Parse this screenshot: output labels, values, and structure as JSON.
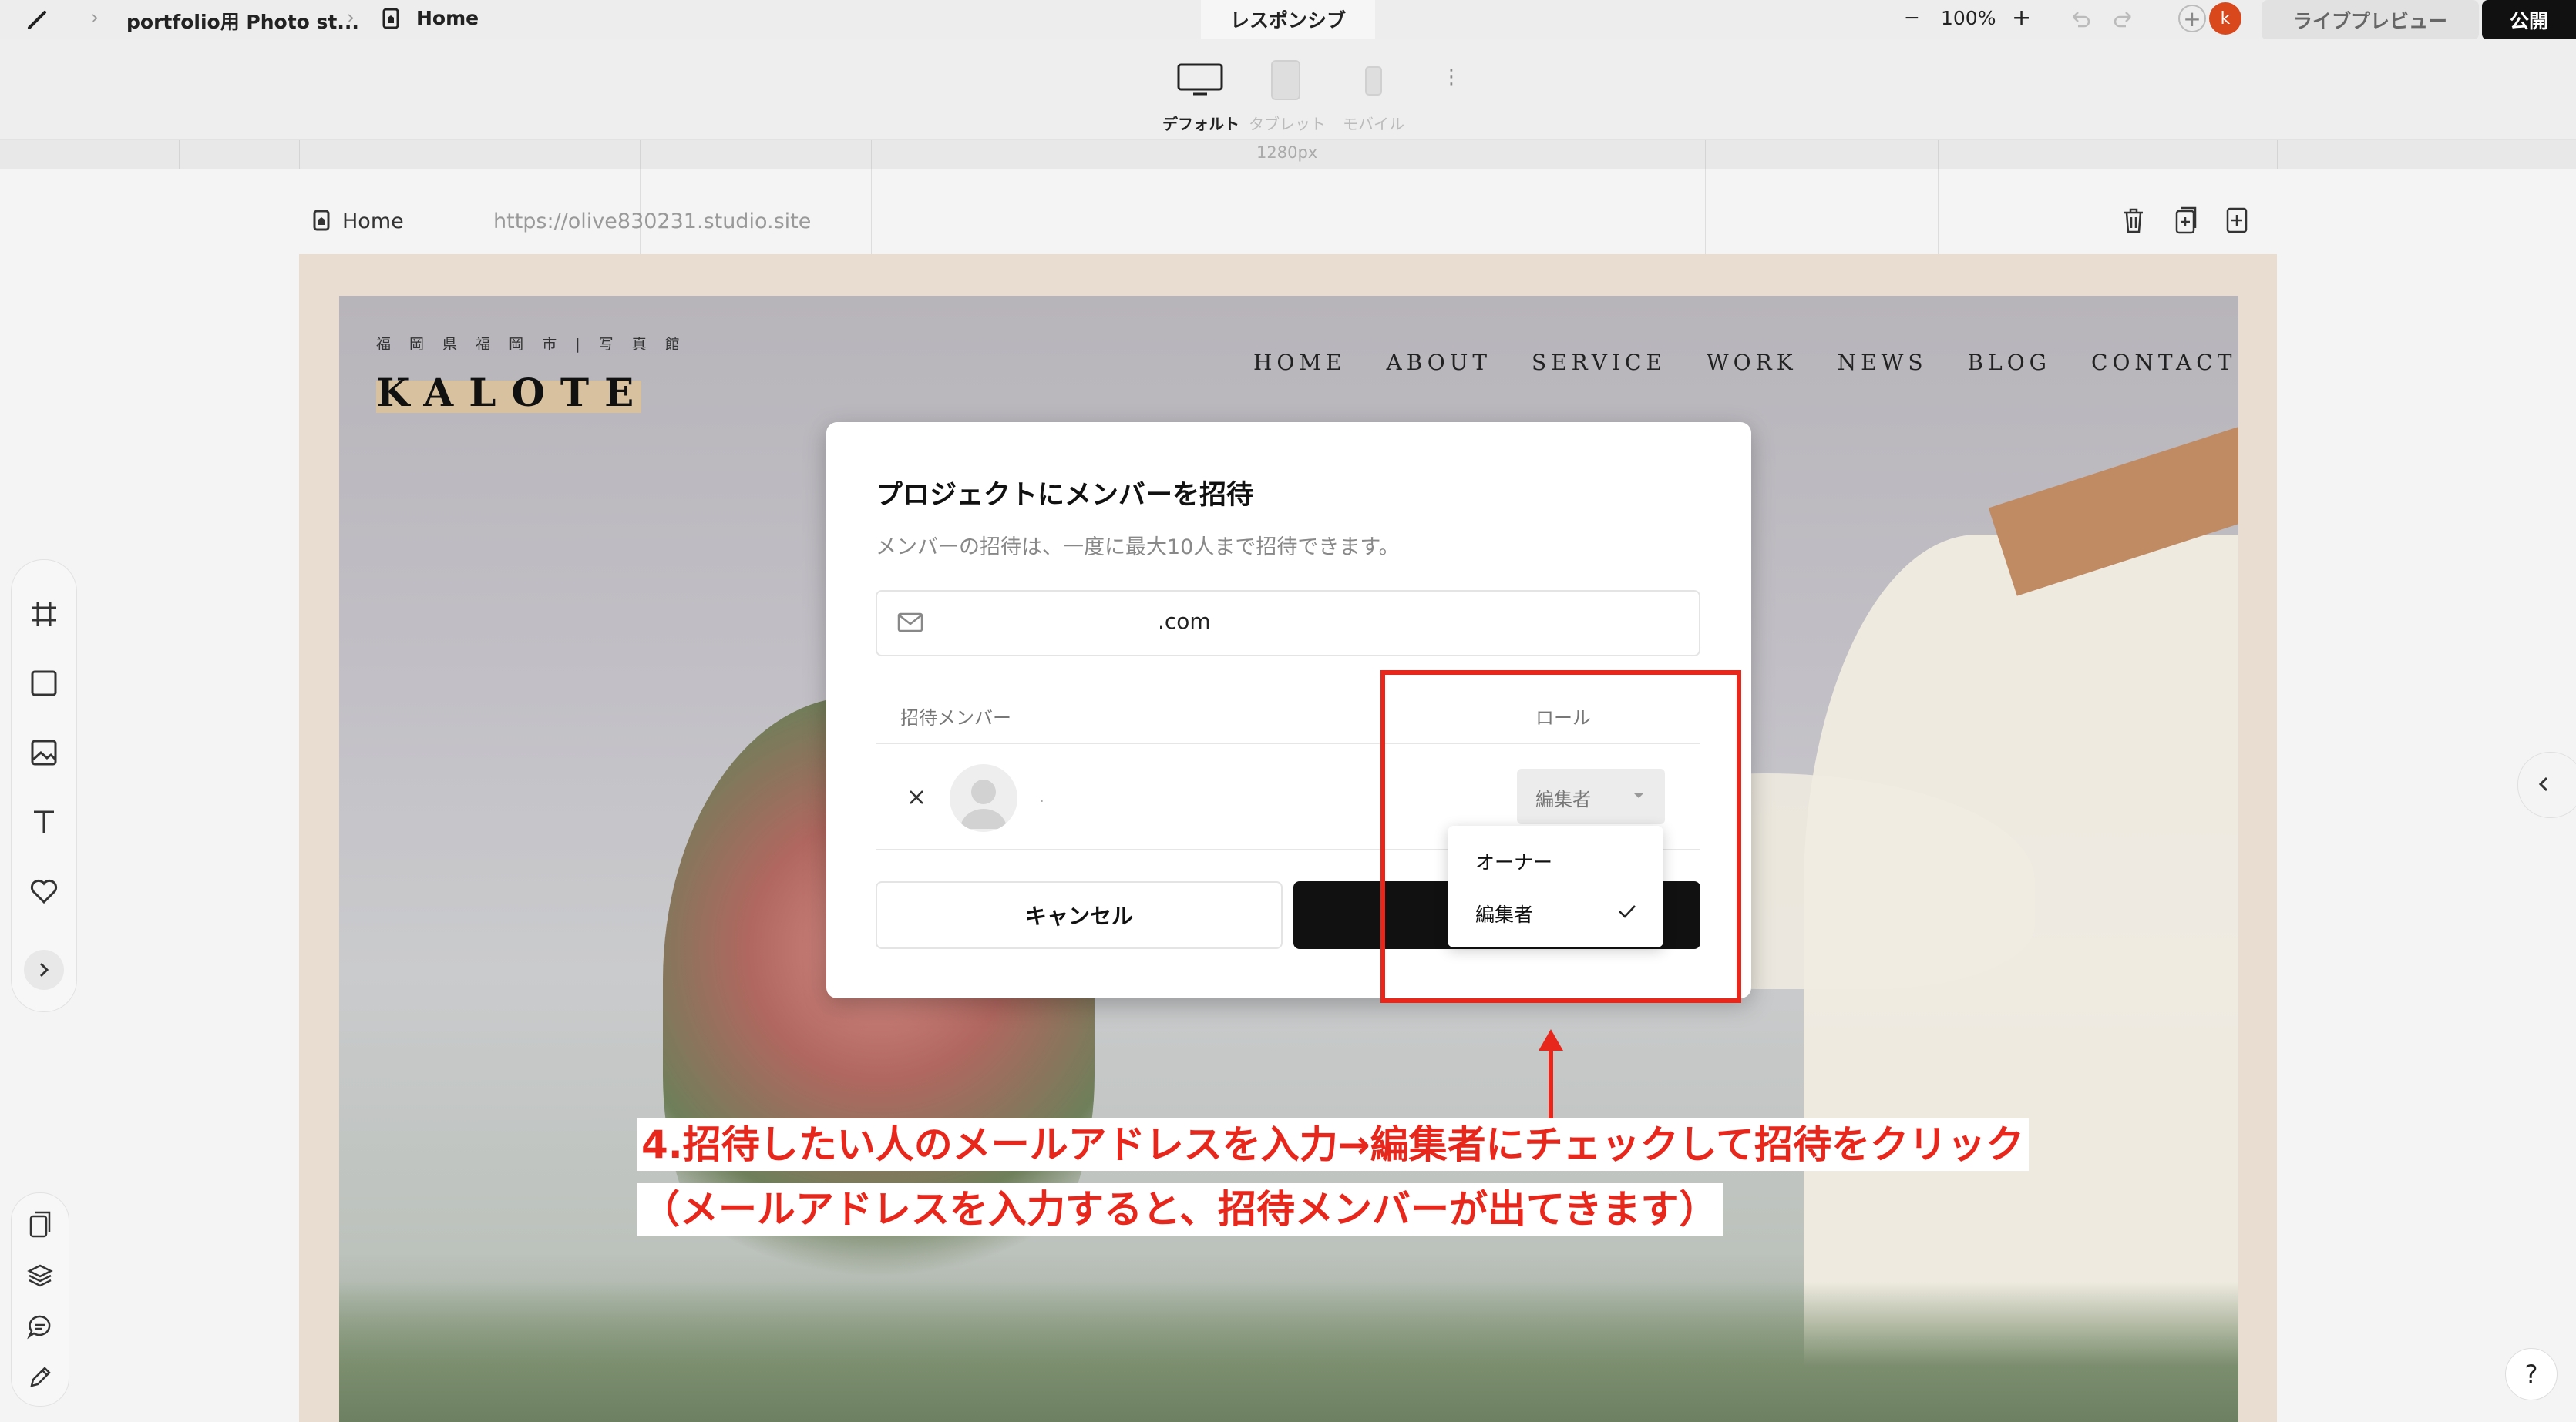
{
  "topbar": {
    "breadcrumb_project": "portfolio用 Photo st...",
    "breadcrumb_page": "Home",
    "tab_label": "レスポンシブ",
    "zoom": "100%",
    "avatar_initial": "k",
    "preview_label": "ライブプレビュー",
    "publish_label": "公開"
  },
  "devices": {
    "items": [
      {
        "label": "デフォルト",
        "active": true
      },
      {
        "label": "タブレット",
        "active": false
      },
      {
        "label": "モバイル",
        "active": false
      }
    ],
    "ruler_label": "1280px"
  },
  "page": {
    "name": "Home",
    "url": "https://olive830231.studio.site"
  },
  "site": {
    "tagline": "福 岡 県 福 岡 市 | 写 真 館",
    "logo": "KALOTE",
    "nav": [
      "HOME",
      "ABOUT",
      "SERVICE",
      "WORK",
      "NEWS",
      "BLOG",
      "CONTACT"
    ]
  },
  "modal": {
    "title": "プロジェクトにメンバーを招待",
    "description": "メンバーの招待は、一度に最大10人まで招待できます。",
    "email_value": ".com",
    "col_member": "招待メンバー",
    "col_role": "ロール",
    "member_name": ".",
    "selected_role": "編集者",
    "cancel_label": "キャンセル",
    "dropdown_options": [
      "オーナー",
      "編集者"
    ],
    "checked_option": "編集者"
  },
  "annotation": {
    "line1": "4.招待したい人のメールアドレスを入力→編集者にチェックして招待をクリック",
    "line2": "（メールアドレスを入力すると、招待メンバーが出てきます）",
    "color": "#e8271c"
  },
  "help_label": "?"
}
